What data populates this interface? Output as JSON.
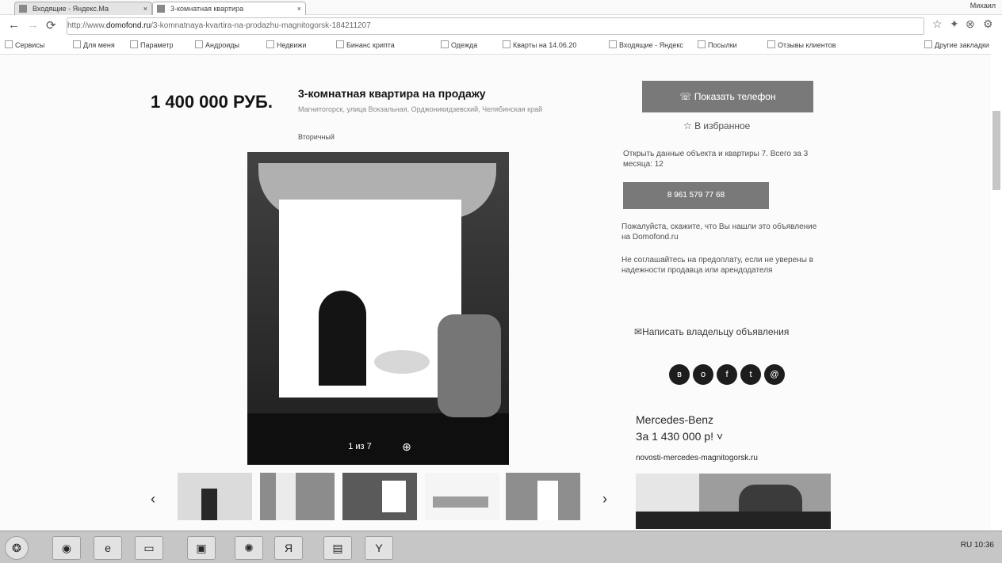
{
  "browser": {
    "tabs": [
      {
        "label": "Входящие - Яндекс.Ма"
      },
      {
        "label": "3-комнатная квартира"
      }
    ],
    "user": "Михаил",
    "address_prefix": "http://www.",
    "address_domain": "domofond.ru",
    "address_rest": "/3-komnatnaya-kvartira-na-prodazhu-magnitogorsk-184211207",
    "bookmarks": [
      "Сервисы",
      "Для меня",
      "Параметр",
      "Андроиды",
      "Недвижи",
      "Бинанс крипта",
      "Одежда",
      "Кварты на 14.06.20",
      "Входящие - Яндекс",
      "Посылки",
      "Отзывы клиентов",
      "Другие закладки"
    ]
  },
  "listing": {
    "price": "1 400 000 РУБ.",
    "title": "3-комнатная квартира на продажу",
    "address": "Магнитогорск, улица Вокзальная, Орджоникидзевский, Челябинская край",
    "type": "Вторичный",
    "photo_counter": "1 из 7"
  },
  "sidebar": {
    "show_phone": "Показать телефон",
    "favorite": "В избранное",
    "views": "Открыть данные объекта и квартиры 7. Всего за 3 месяца: 12",
    "phone": "8 961 579 77 68",
    "note1": "Пожалуйста, скажите, что Вы нашли это объявление на Domofond.ru",
    "note2": "Не соглашайтесь на предоплату, если не уверены в надежности продавца или арендодателя",
    "write_owner": "Написать владельцу объявления",
    "socials": [
      "vk-icon",
      "ok-icon",
      "facebook-icon",
      "twitter-icon",
      "mail-icon"
    ]
  },
  "ad": {
    "title": "Mercedes-Benz",
    "price": "За 1 430 000 р! ˅",
    "site": "novosti-mercedes-magnitogorsk.ru"
  },
  "taskbar": {
    "tray_text": "RU  10:36"
  }
}
